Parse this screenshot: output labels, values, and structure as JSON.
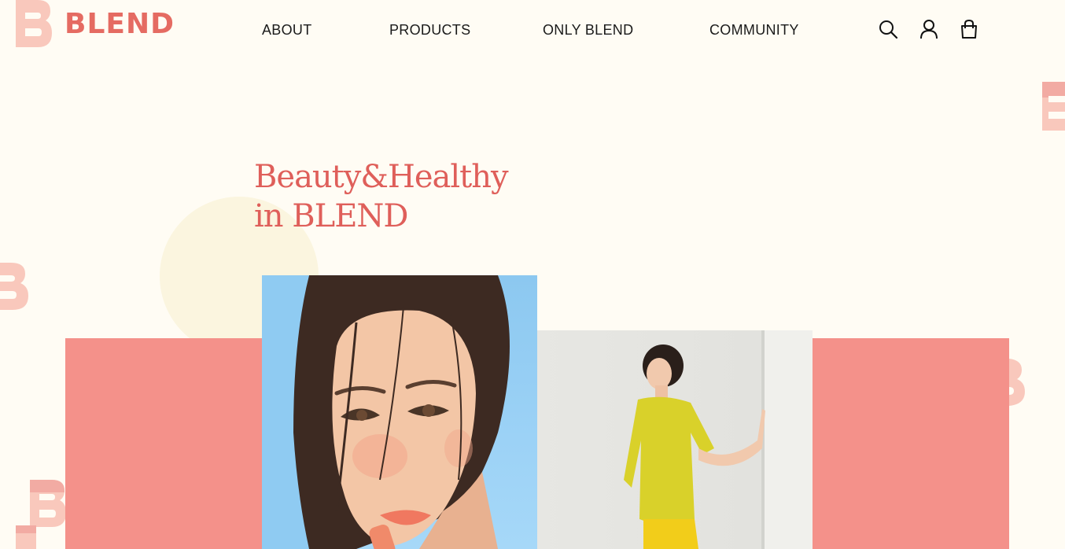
{
  "brand": {
    "name": "BLEND"
  },
  "nav": {
    "items": [
      "ABOUT",
      "PRODUCTS",
      "ONLY BLEND",
      "COMMUNITY"
    ]
  },
  "header_icons": [
    "search-icon",
    "user-icon",
    "shopping-bag-icon"
  ],
  "hero": {
    "title_line1": "Beauty&Healthy",
    "title_line2": "in BLEND"
  },
  "colors": {
    "background": "#fffcf4",
    "brand_coral": "#e56b62",
    "block_pink": "#f4918a",
    "circle_cream": "#fbf5df",
    "logo_peach": "#f9c8bc"
  }
}
